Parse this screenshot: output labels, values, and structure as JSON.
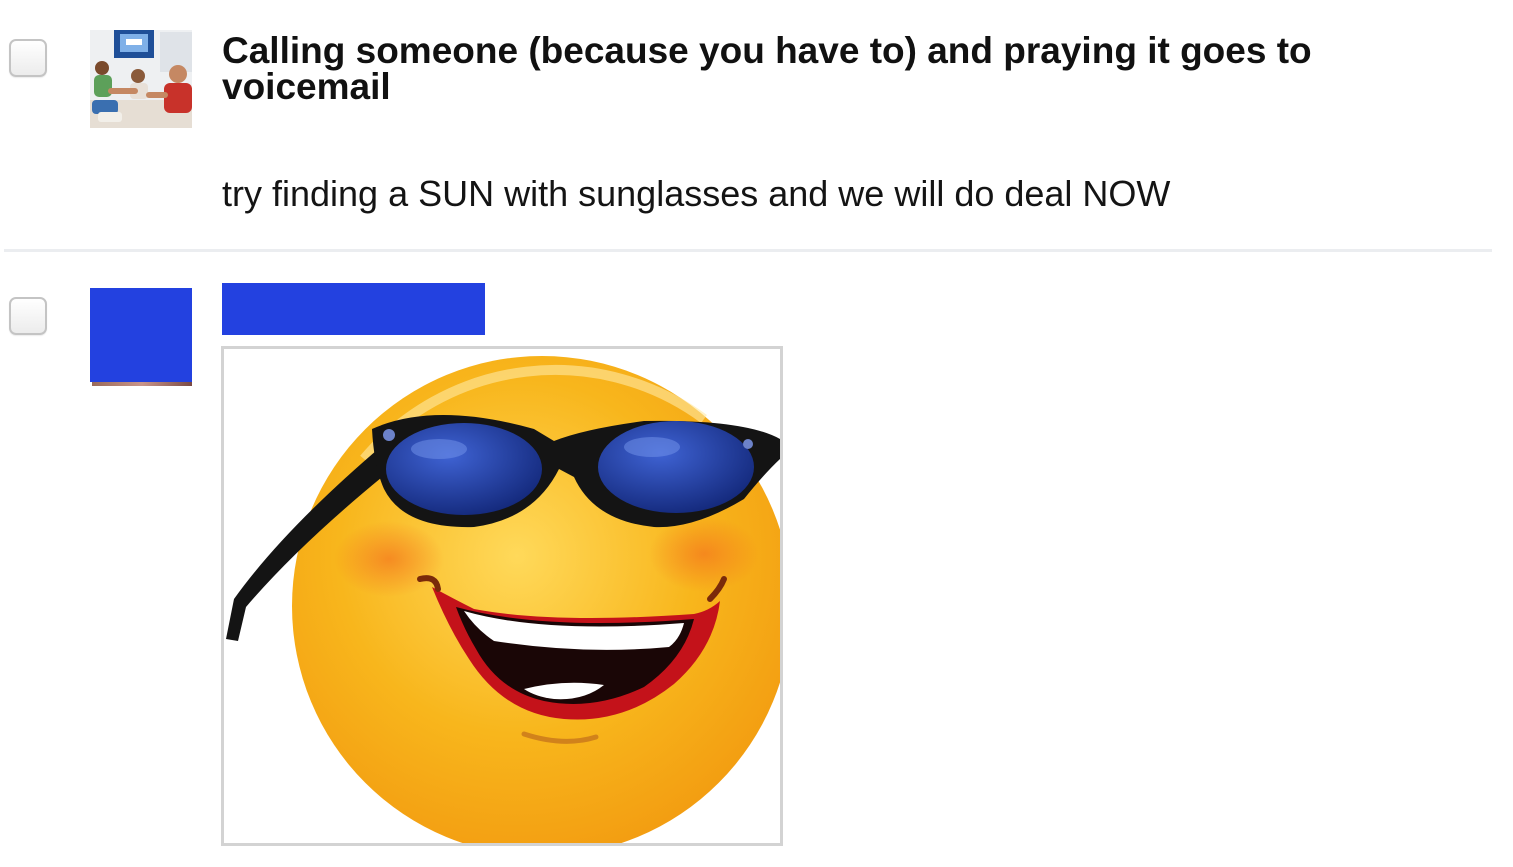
{
  "messages": [
    {
      "sender": "Calling someone (because you have to) and praying it goes to voicemail",
      "text": "try finding a SUN with sunglasses and we will do deal NOW",
      "avatar": "group-photo"
    },
    {
      "sender": "",
      "sender_redacted": true,
      "avatar": "redacted",
      "attachment": "sun-with-sunglasses-image"
    }
  ],
  "colors": {
    "redaction": "#2341e0",
    "divider": "#ebedf0",
    "sun": "#f7b218",
    "lenses": "#1d3a9e"
  }
}
